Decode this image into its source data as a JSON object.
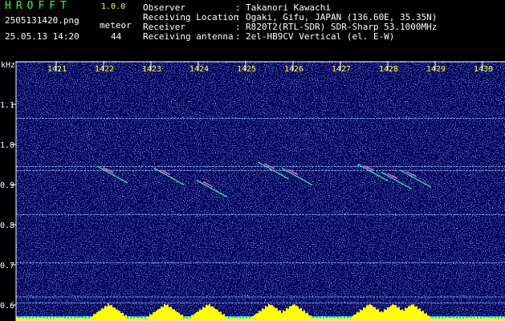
{
  "header": {
    "app_name": "HROFFT",
    "version": "1.0.0",
    "filename": "2505131420.png",
    "meteor_label": "meteor",
    "datetime": "25.05.13 14:20",
    "meteor_count": "44"
  },
  "station": [
    {
      "label": "Observer",
      "value": "Takanori Kawachi"
    },
    {
      "label": "Receiving Location",
      "value": "Ogaki, Gifu, JAPAN (136.60E, 35.35N)"
    },
    {
      "label": "Receiver",
      "value": "R820T2(RTL-SDR) SDR-Sharp 53.1000MHz"
    },
    {
      "label": "Receiving antenna",
      "value": "2el-HB9CV Vertical (el. E-W)"
    }
  ],
  "separator": ":",
  "chart_data": {
    "type": "heatmap",
    "xlabel": "",
    "ylabel": "kHz",
    "x_ticks": [
      "1421",
      "1422",
      "1423",
      "1424",
      "1425",
      "1426",
      "1427",
      "1428",
      "1429",
      "1430"
    ],
    "y_ticks": [
      "1.1",
      "1.0",
      "0.9",
      "0.8",
      "0.7",
      "0.6"
    ],
    "ylim": [
      0.58,
      1.2
    ],
    "carrier_lines_khz": [
      1.065,
      0.945,
      0.935,
      0.825,
      0.705,
      0.62,
      0.605
    ],
    "meteor_echoes": [
      {
        "time": "1422.1",
        "khz": 0.94
      },
      {
        "time": "1423.3",
        "khz": 0.935
      },
      {
        "time": "1424.2",
        "khz": 0.905
      },
      {
        "time": "1425.5",
        "khz": 0.95
      },
      {
        "time": "1426.0",
        "khz": 0.935
      },
      {
        "time": "1427.6",
        "khz": 0.945
      },
      {
        "time": "1428.1",
        "khz": 0.925
      },
      {
        "time": "1428.5",
        "khz": 0.93
      }
    ],
    "colors": {
      "background": "#00005a",
      "axis": "#ffffff",
      "tick_label": "#ffff33",
      "level_fill": "#ffff00",
      "level_base": "#00c8ff"
    }
  }
}
